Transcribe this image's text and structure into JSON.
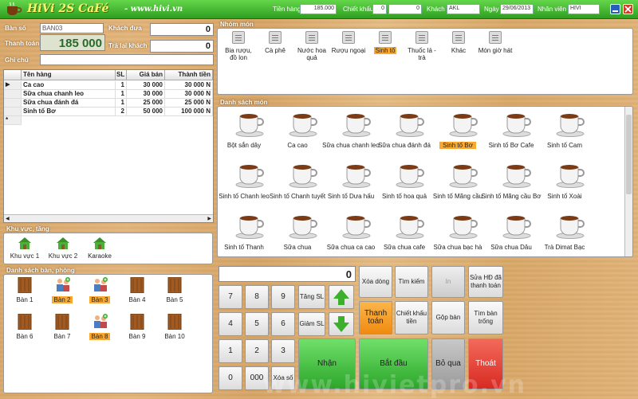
{
  "header": {
    "app_title": "HiVi 2S CaFé",
    "url": "www.hivi.vn",
    "tien_hang_label": "Tiền hàng",
    "tien_hang_value": "185.000",
    "chiet_khau_label": "Chiết khấu",
    "chiet_khau_pct": "0",
    "chiet_khau_value": "0",
    "khach_label": "Khách",
    "khach_value": "AKL",
    "ngay_label": "Ngày",
    "ngay_value": "29/06/2013",
    "nhan_vien_label": "Nhân viên",
    "nhan_vien_value": "HIVI"
  },
  "order": {
    "ban_so_label": "Bàn số",
    "ban_so_value": "BAN03",
    "khach_dua_label": "Khách đưa",
    "khach_dua_value": "0",
    "thanh_toan_label": "Thanh toán",
    "thanh_toan_value": "185 000",
    "tra_lai_label": "Trả lại khách",
    "tra_lai_value": "0",
    "ghi_chu_label": "Ghi chú"
  },
  "grid": {
    "headers": [
      "Tên hàng",
      "SL",
      "Giá bán",
      "Thành tiền"
    ],
    "rows": [
      [
        "Ca cao",
        "1",
        "30 000",
        "30 000 N"
      ],
      [
        "Sữa chua chanh leo",
        "1",
        "30 000",
        "30 000 N"
      ],
      [
        "Sữa chua đánh đá",
        "1",
        "25 000",
        "25 000 N"
      ],
      [
        "Sinh tố Bơ",
        "2",
        "50 000",
        "100 000 N"
      ]
    ]
  },
  "areas": {
    "title": "Khu vực, tầng",
    "items": [
      "Khu vực 1",
      "Khu vực 2",
      "Karaoke"
    ]
  },
  "tables": {
    "title": "Danh sách bàn, phòng",
    "items": [
      "Bàn 1",
      "Bàn 2",
      "Bàn 3",
      "Bàn 4",
      "Bàn 5",
      "Bàn 6",
      "Bàn 7",
      "Bàn 8",
      "Bàn 9",
      "Bàn 10"
    ]
  },
  "groups": {
    "title": "Nhóm món",
    "items": [
      "Bia rượu, đồ lon",
      "Cà phê",
      "Nước hoa quả",
      "Rượu ngoại",
      "Sinh tố",
      "Thuốc lá - trà",
      "Khác",
      "Món giờ hát"
    ],
    "selected": "Sinh tố"
  },
  "menu": {
    "title": "Danh sách món",
    "items": [
      "Bột sắn dây",
      "Ca cao",
      "Sữa chua chanh leo",
      "Sữa chua đánh đá",
      "Sinh tố Bơ",
      "Sinh tố Bơ Cafe",
      "Sinh tố Cam",
      "Sinh tố Chanh leo",
      "Sinh tố Chanh tuyết",
      "Sinh tố Dưa hấu",
      "Sinh tố hoa quả",
      "Sinh tố Mãng cầu",
      "Sinh tố Mãng cầu Bơ",
      "Sinh tố Xoài",
      "Sinh tố Thanh",
      "Sữa chua",
      "Sữa chua ca cao",
      "Sữa chua cafe",
      "Sữa chua bạc hà",
      "Sữa chua Dâu",
      "Trà Dimat Bạc"
    ],
    "selected": "Sinh tố Bơ"
  },
  "keypad": {
    "display": "0",
    "keys": [
      "7",
      "8",
      "9",
      "4",
      "5",
      "6",
      "1",
      "2",
      "3",
      "0",
      "000"
    ],
    "xoa_so": "Xóa số",
    "tang_sl": "Tăng SL",
    "giam_sl": "Giảm SL"
  },
  "actions": {
    "xoa_dong": "Xóa dòng",
    "tim_kiem": "Tìm kiếm",
    "in": "In",
    "sua_hd": "Sửa HĐ đã thanh toán",
    "thanh_toan": "Thanh toán",
    "chiet_khau_tien": "Chiết khấu tiền",
    "gop_ban": "Gộp bàn",
    "tim_ban_trong": "Tìm bàn trống",
    "nhan": "Nhận",
    "bat_dau": "Bắt đầu",
    "bo_qua": "Bỏ qua",
    "thoat": "Thoát"
  },
  "colors": {
    "green": "#3cb02c",
    "orange": "#f9a830",
    "red": "#e83a32"
  },
  "watermark": "www.hivietpro.vn"
}
